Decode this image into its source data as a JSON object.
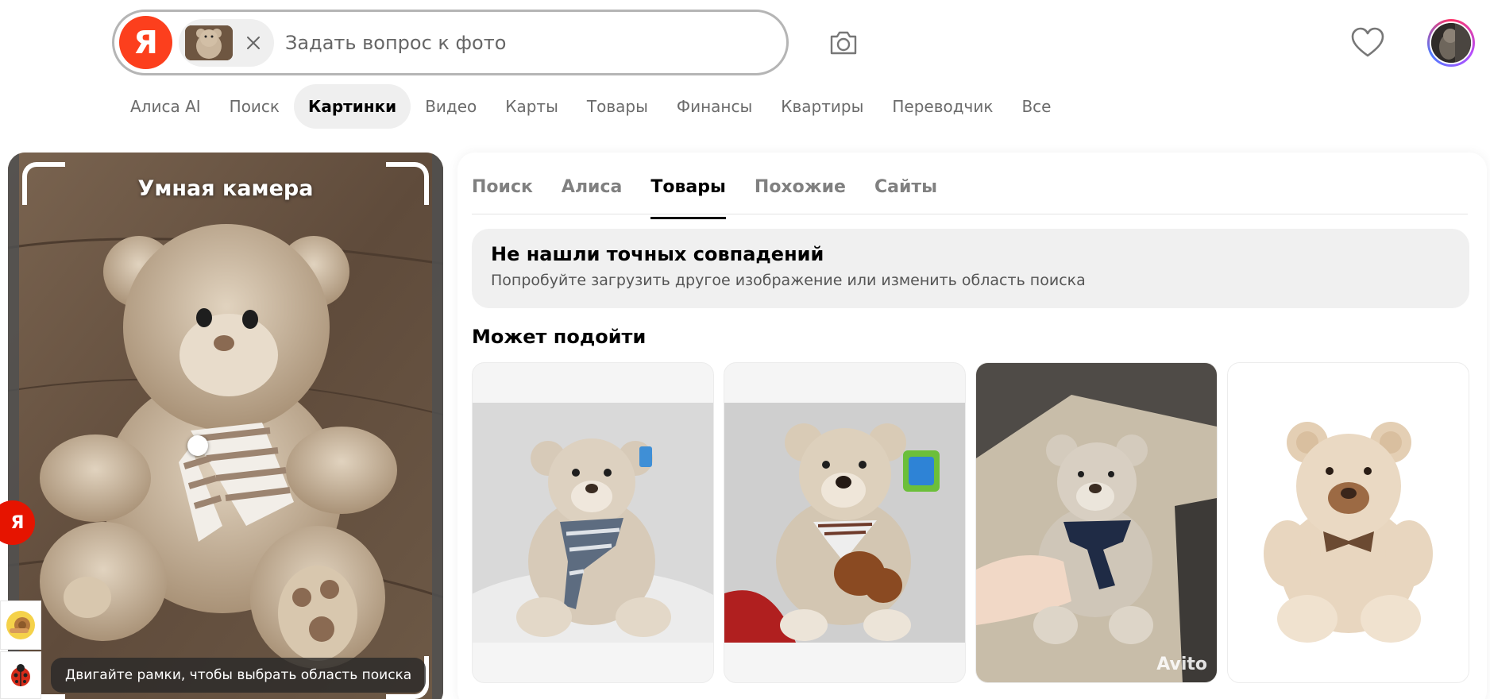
{
  "header": {
    "logo_letter": "Я",
    "search_placeholder": "Задать вопрос к фото",
    "icons": {
      "clear": "close-icon",
      "camera": "camera-icon",
      "favorites": "heart-icon"
    }
  },
  "services": [
    {
      "label": "Алиса AI",
      "active": false
    },
    {
      "label": "Поиск",
      "active": false
    },
    {
      "label": "Картинки",
      "active": true
    },
    {
      "label": "Видео",
      "active": false
    },
    {
      "label": "Карты",
      "active": false
    },
    {
      "label": "Товары",
      "active": false
    },
    {
      "label": "Финансы",
      "active": false
    },
    {
      "label": "Квартиры",
      "active": false
    },
    {
      "label": "Переводчик",
      "active": false
    },
    {
      "label": "Все",
      "active": false
    }
  ],
  "camera_panel": {
    "title": "Умная камера",
    "hint": "Двигайте рамки, чтобы выбрать область поиска"
  },
  "side_widget": {
    "letter": "Я"
  },
  "results": {
    "tabs": [
      {
        "label": "Поиск",
        "active": false
      },
      {
        "label": "Алиса",
        "active": false
      },
      {
        "label": "Товары",
        "active": true
      },
      {
        "label": "Похожие",
        "active": false
      },
      {
        "label": "Сайты",
        "active": false
      }
    ],
    "no_match_title": "Не нашли точных совпадений",
    "no_match_subtitle": "Попробуйте загрузить другое изображение или изменить область поиска",
    "suggest_heading": "Может подойти",
    "watermark": "Avito"
  },
  "colors": {
    "brand_red": "#fc3f1d",
    "active_chip_bg": "#efefef",
    "notice_bg": "#f0f0f0"
  }
}
